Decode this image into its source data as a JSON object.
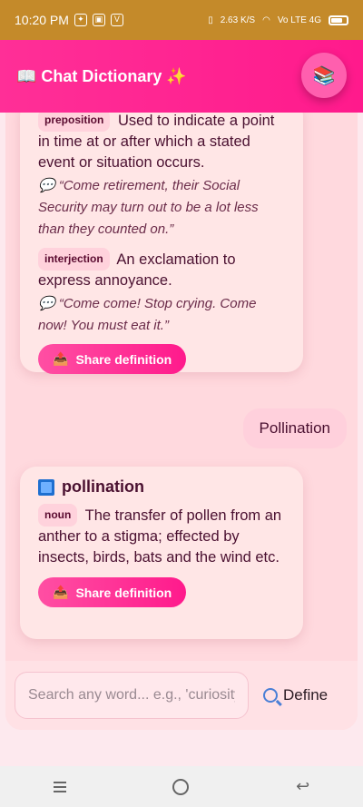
{
  "status_bar": {
    "time": "10:20 PM",
    "speed": "2.63 K/S",
    "network": "Vo LTE 4G"
  },
  "app_bar": {
    "title": "📖 Chat Dictionary ✨",
    "action_icon": "📚"
  },
  "messages": [
    {
      "type": "bot",
      "definitions": [
        {
          "pos": "preposition",
          "text": "Used to indicate a point in time at or after which a stated event or situation occurs.",
          "example": "💬 “Come retirement, their Social Security may turn out to be a lot less than they counted on.”"
        },
        {
          "pos": "interjection",
          "text": "An exclamation to express annoyance.",
          "example": "💬 “Come come! Stop crying.     Come now! You must eat it.”"
        }
      ],
      "share_label": "Share definition",
      "share_icon": "📤"
    },
    {
      "type": "user",
      "text": "Pollination"
    },
    {
      "type": "bot",
      "word": "pollination",
      "definitions": [
        {
          "pos": "noun",
          "text": "The transfer of pollen from an anther to a stigma; effected by insects, birds, bats and the wind etc."
        }
      ],
      "share_label": "Share definition",
      "share_icon": "📤"
    }
  ],
  "input": {
    "placeholder": "Search any word... e.g., 'curiosity'",
    "value": ""
  },
  "define_button": {
    "label": "Define",
    "icon": "🔍"
  },
  "colors": {
    "accent": "#ff1a8c",
    "status_bar": "#c48a2a",
    "chat_bg": "#ffd9de",
    "card_bg": "#ffe6e6"
  }
}
